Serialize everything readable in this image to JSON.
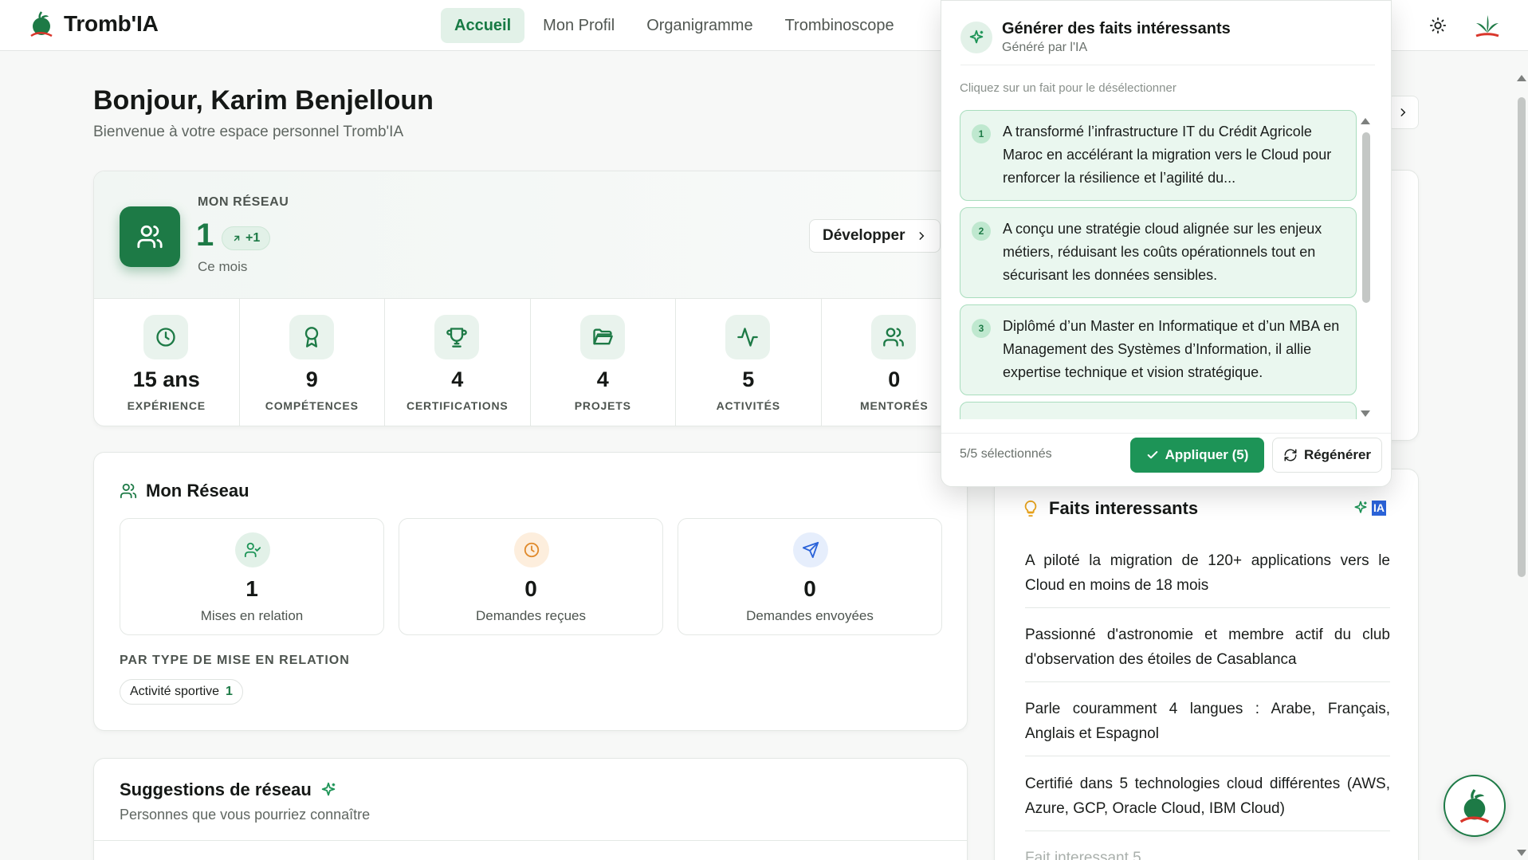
{
  "app": {
    "name": "Tromb'IA"
  },
  "nav": {
    "tabs": [
      "Accueil",
      "Mon Profil",
      "Organigramme",
      "Trombinoscope"
    ],
    "active": 0
  },
  "colors": {
    "accent": "#1d7a46",
    "accent_light": "#e2f1e8",
    "apply_green": "#1d9457",
    "ia_blue": "#2b63d9",
    "tomato_red": "#d9362b"
  },
  "greeting": {
    "title": "Bonjour, Karim Benjelloun",
    "subtitle": "Bienvenue à votre espace personnel Tromb'IA"
  },
  "hero": {
    "label": "MON RÉSEAU",
    "count": "1",
    "delta": "+1",
    "period": "Ce mois",
    "button": "Développer",
    "stats": [
      {
        "icon": "clock-icon",
        "value": "15 ans",
        "label": "EXPÉRIENCE"
      },
      {
        "icon": "award-icon",
        "value": "9",
        "label": "COMPÉTENCES"
      },
      {
        "icon": "trophy-icon",
        "value": "4",
        "label": "CERTIFICATIONS"
      },
      {
        "icon": "folder-icon",
        "value": "4",
        "label": "PROJETS"
      },
      {
        "icon": "activity-icon",
        "value": "5",
        "label": "ACTIVITÉS"
      },
      {
        "icon": "users-icon",
        "value": "0",
        "label": "MENTORÉS"
      }
    ]
  },
  "network": {
    "title": "Mon Réseau",
    "boxes": [
      {
        "icon": "user-check-icon",
        "value": "1",
        "label": "Mises en relation"
      },
      {
        "icon": "clock-icon",
        "value": "0",
        "label": "Demandes reçues"
      },
      {
        "icon": "send-icon",
        "value": "0",
        "label": "Demandes envoyées"
      }
    ],
    "by_type_label": "PAR TYPE DE MISE EN RELATION",
    "chip": {
      "label": "Activité sportive",
      "count": "1"
    }
  },
  "suggestions": {
    "title": "Suggestions de réseau",
    "subtitle": "Personnes que vous pourriez connaître"
  },
  "faits": {
    "title": "Faits interessants",
    "ia_badge": "IA",
    "items": [
      "A piloté la migration de 120+ applications vers le Cloud en moins de 18 mois",
      "Passionné d'astronomie et membre actif du club d'observation des étoiles de Casablanca",
      "Parle couramment 4 langues : Arabe, Français, Anglais et Espagnol",
      "Certifié dans 5 technologies cloud différentes (AWS, Azure, GCP, Oracle Cloud, IBM Cloud)"
    ],
    "placeholder": "Fait interessant 5"
  },
  "popover": {
    "title": "Générer des faits intéressants",
    "subtitle": "Généré par l'IA",
    "hint": "Cliquez sur un fait pour le désélectionner",
    "items": [
      {
        "num": "1",
        "text": "A transformé l’infrastructure IT du Crédit Agricole Maroc en accélérant la migration vers le Cloud pour renforcer la résilience et l’agilité du..."
      },
      {
        "num": "2",
        "text": "A conçu une stratégie cloud alignée sur les enjeux métiers, réduisant les coûts opérationnels tout en sécurisant les données sensibles."
      },
      {
        "num": "3",
        "text": "Diplômé d’un Master en Informatique et d’un MBA en Management des Systèmes d’Information, il allie expertise technique et vision stratégique."
      }
    ],
    "selected": "5/5 sélectionnés",
    "apply_label": "Appliquer (5)",
    "regen_label": "Régénérer"
  }
}
